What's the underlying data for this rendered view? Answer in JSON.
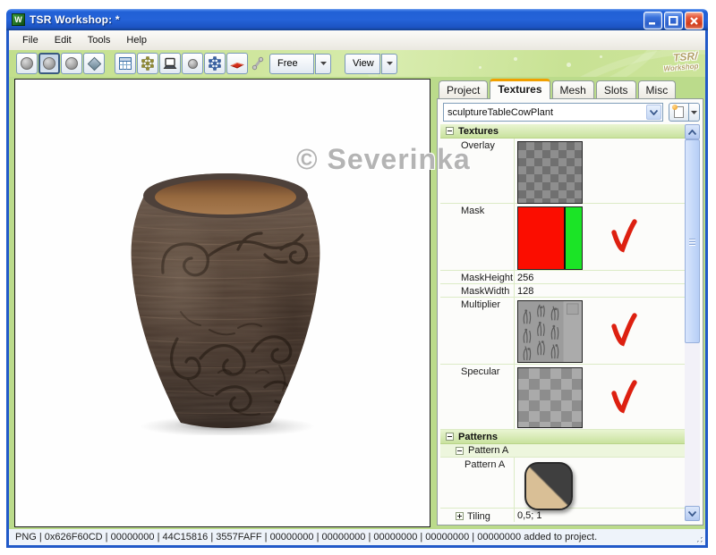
{
  "window": {
    "title": "TSR Workshop: *",
    "icon_letter": "W"
  },
  "menu": {
    "items": [
      {
        "label": "File"
      },
      {
        "label": "Edit"
      },
      {
        "label": "Tools"
      },
      {
        "label": "Help"
      }
    ]
  },
  "toolbar": {
    "free_label": "Free",
    "view_label": "View",
    "logo_line1": "TSR/",
    "logo_line2": "Workshop"
  },
  "canvas": {
    "watermark": "© Severinka"
  },
  "tabs": [
    {
      "label": "Project"
    },
    {
      "label": "Textures",
      "active": true
    },
    {
      "label": "Mesh"
    },
    {
      "label": "Slots"
    },
    {
      "label": "Misc"
    }
  ],
  "panel": {
    "resource_value": "sculptureTableCowPlant"
  },
  "grid": {
    "sections": {
      "textures_title": "Textures",
      "patterns_title": "Patterns"
    },
    "rows": {
      "overlay": {
        "label": "Overlay"
      },
      "mask": {
        "label": "Mask"
      },
      "mask_height": {
        "label": "MaskHeight",
        "value": "256"
      },
      "mask_width": {
        "label": "MaskWidth",
        "value": "128"
      },
      "multiplier": {
        "label": "Multiplier"
      },
      "specular": {
        "label": "Specular"
      }
    },
    "patterns": {
      "group_label": "Pattern A",
      "row_label": "Pattern A",
      "tiling_label": "Tiling",
      "tiling_value": "0,5; 1"
    }
  },
  "status": {
    "text": "PNG | 0x626F60CD | 00000000 | 44C15816 | 3557FAFF | 00000000 | 00000000 | 00000000 | 00000000 | 00000000 added to project."
  },
  "colors": {
    "title_blue": "#2563D8",
    "banner_green": "#CDE79F",
    "section_green": "#D3E8AC",
    "check_red": "#DD2010",
    "mask_red": "#FB0D00",
    "mask_green": "#1BE426",
    "pattern_tan": "#D9BF96",
    "pattern_dark": "#3F3F3F"
  }
}
